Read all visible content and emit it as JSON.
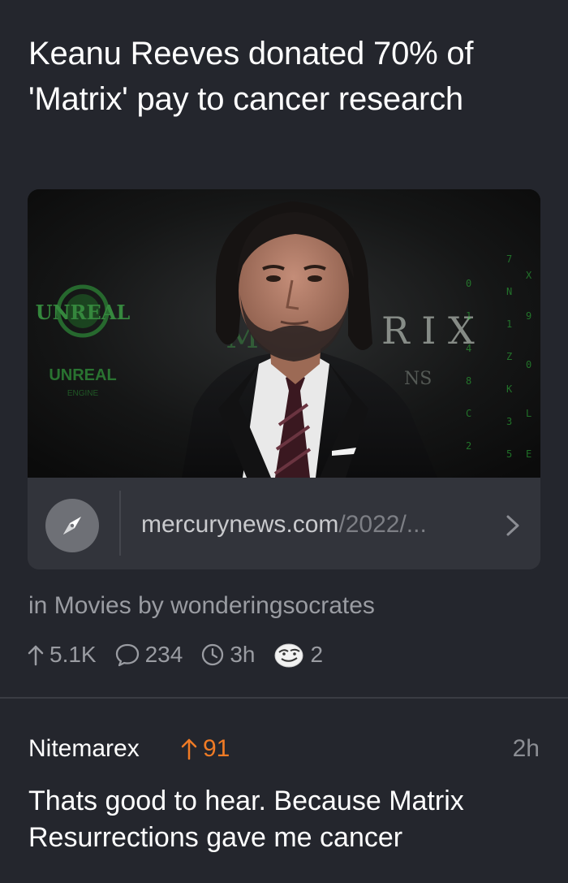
{
  "post": {
    "title": "Keanu Reeves donated 70% of 'Matrix' pay to cancer research",
    "link": {
      "domain": "mercurynews.com",
      "path": "/2022/...",
      "icon": "compass-icon",
      "image_signage": [
        "UNREAL",
        "ENGINE",
        "R I X",
        "NS"
      ]
    },
    "meta": {
      "prefix": "in",
      "community": "Movies",
      "by_label": "by",
      "author": "wonderingsocrates"
    },
    "stats": {
      "upvotes": "5.1K",
      "comments": "234",
      "age": "3h",
      "awards": "2"
    }
  },
  "comment": {
    "author": "Nitemarex",
    "score": "91",
    "time": "2h",
    "body": "Thats good to hear. Because Matrix Resurrections gave me cancer"
  },
  "colors": {
    "background": "#24262d",
    "card": "#32343b",
    "muted_text": "#9a9ca2",
    "upvote_accent": "#f07b25"
  }
}
